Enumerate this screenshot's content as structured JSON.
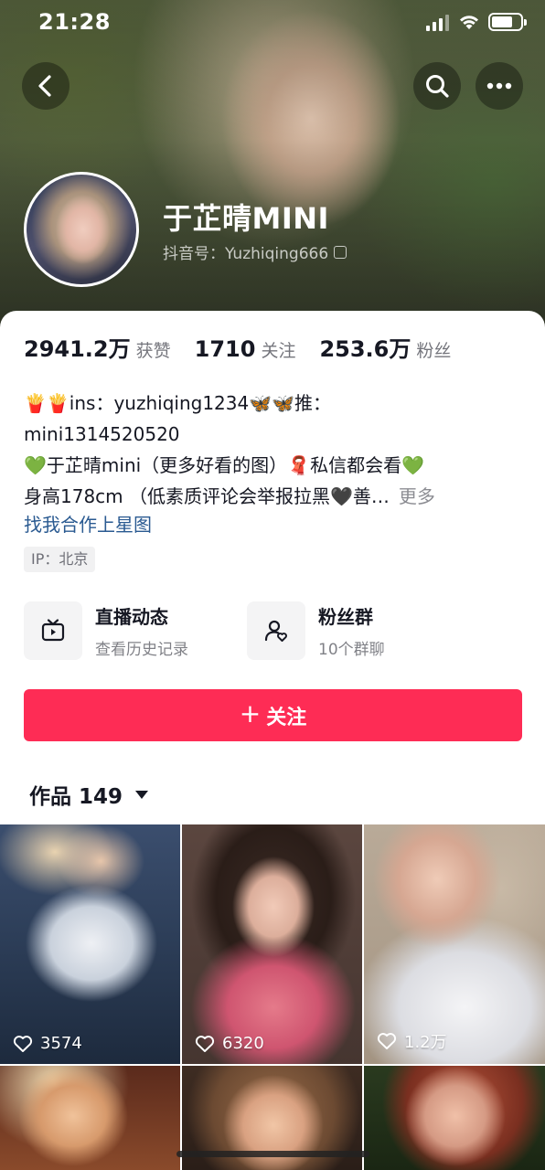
{
  "status_bar": {
    "time": "21:28"
  },
  "profile": {
    "name": "于芷晴MINI",
    "douyin_id": "抖音号：Yuzhiqing666"
  },
  "stats": [
    {
      "num": "2941.2万",
      "label": "获赞"
    },
    {
      "num": "1710",
      "label": "关注"
    },
    {
      "num": "253.6万",
      "label": "粉丝"
    }
  ],
  "bio": {
    "line1": "🍟🍟ins：yuzhiqing1234🦋🦋推：",
    "line2": "mini1314520520",
    "line3": "💚于芷晴mini（更多好看的图）🧣私信都会看💚",
    "line4": "身高178cm （低素质评论会举报拉黑🖤善…",
    "more": "更多",
    "collab": "找我合作上星图",
    "ip": "IP：北京"
  },
  "features": [
    {
      "title": "直播动态",
      "subtitle": "查看历史记录"
    },
    {
      "title": "粉丝群",
      "subtitle": "10个群聊"
    }
  ],
  "follow_button": {
    "plus": "+",
    "label": "关注"
  },
  "works": {
    "label": "作品 149"
  },
  "grid": [
    {
      "likes": "3574"
    },
    {
      "likes": "6320"
    },
    {
      "likes": "1.2万"
    },
    {
      "likes": ""
    },
    {
      "likes": ""
    },
    {
      "likes": ""
    }
  ],
  "colors": {
    "accent": "#fe2c55",
    "link": "#2a5a91"
  }
}
